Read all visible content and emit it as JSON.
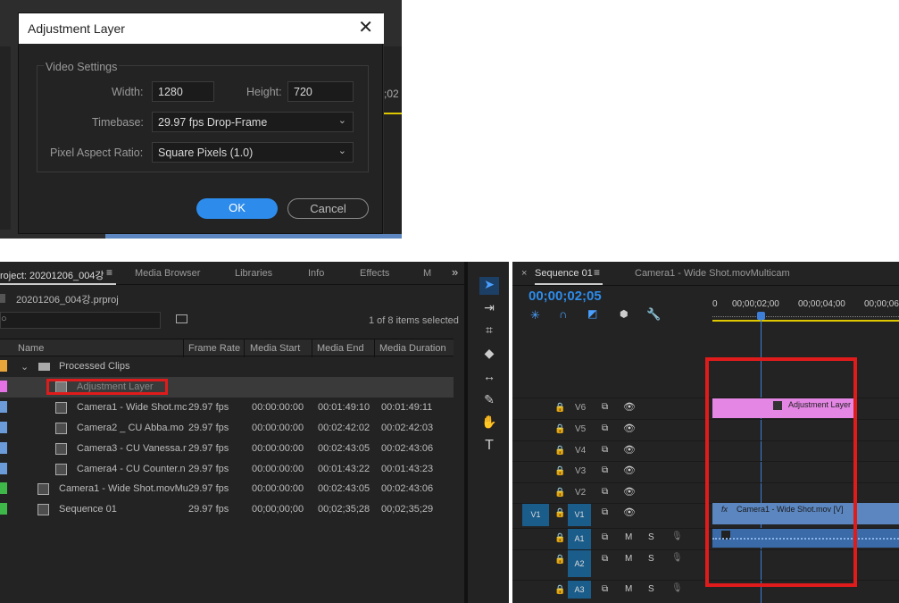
{
  "dialog": {
    "title": "Adjustment Layer",
    "group_label": "Video Settings",
    "width_label": "Width:",
    "width_value": "1280",
    "height_label": "Height:",
    "height_value": "720",
    "timebase_label": "Timebase:",
    "timebase_value": "29.97 fps Drop-Frame",
    "par_label": "Pixel Aspect Ratio:",
    "par_value": "Square Pixels (1.0)",
    "ok": "OK",
    "cancel": "Cancel",
    "bg_timecode": ";02"
  },
  "project": {
    "tabs": [
      "roject: 20201206_004강",
      "Media Browser",
      "Libraries",
      "Info",
      "Effects",
      "M"
    ],
    "file": "20201206_004강.prproj",
    "selected_count": "1 of 8 items selected",
    "columns": [
      "Name",
      "Frame Rate",
      "Media Start",
      "Media End",
      "Media Duration"
    ],
    "folder": "Processed Clips",
    "items": [
      {
        "name": "Adjustment Layer",
        "fps": "",
        "start": "",
        "end": "",
        "dur": "",
        "color": "#e472e4"
      },
      {
        "name": "Camera1 - Wide Shot.mc",
        "fps": "29.97 fps",
        "start": "00:00:00:00",
        "end": "00:01:49:10",
        "dur": "00:01:49:11",
        "color": "#6b9bd8"
      },
      {
        "name": "Camera2 _ CU Abba.mo",
        "fps": "29.97 fps",
        "start": "00:00:00:00",
        "end": "00:02:42:02",
        "dur": "00:02:42:03",
        "color": "#6b9bd8"
      },
      {
        "name": "Camera3 - CU Vanessa.r",
        "fps": "29.97 fps",
        "start": "00:00:00:00",
        "end": "00:02:43:05",
        "dur": "00:02:43:06",
        "color": "#6b9bd8"
      },
      {
        "name": "Camera4 - CU Counter.n",
        "fps": "29.97 fps",
        "start": "00:00:00:00",
        "end": "00:01:43:22",
        "dur": "00:01:43:23",
        "color": "#6b9bd8"
      },
      {
        "name": "Camera1 - Wide Shot.movMu",
        "fps": "29.97 fps",
        "start": "00:00:00:00",
        "end": "00:02:43:05",
        "dur": "00:02:43:06",
        "color": "#3fb84a"
      },
      {
        "name": "Sequence 01",
        "fps": "29.97 fps",
        "start": "00;00;00;00",
        "end": "00;02;35;28",
        "dur": "00;02;35;29",
        "color": "#3fb84a"
      }
    ]
  },
  "timeline": {
    "tab": "Sequence 01",
    "tab2": "Camera1 - Wide Shot.movMulticam",
    "timecode": "00;00;02;05",
    "ruler": [
      "00;00;02;00",
      "00;00;04;00",
      "00;00;06"
    ],
    "ruler_start": "0",
    "tracks": [
      "V6",
      "V5",
      "V4",
      "V3",
      "V2",
      "V1",
      "A1",
      "A2",
      "A3"
    ],
    "source_v": "V1",
    "clip_adjust": "Adjustment Layer",
    "clip_cam": "Camera1 - Wide Shot.mov [V]",
    "mute": "M",
    "solo": "S"
  },
  "colors": {
    "highlight": "#e01b1b",
    "accent": "#2d8ceb",
    "playhead": "#3d7fd8"
  }
}
